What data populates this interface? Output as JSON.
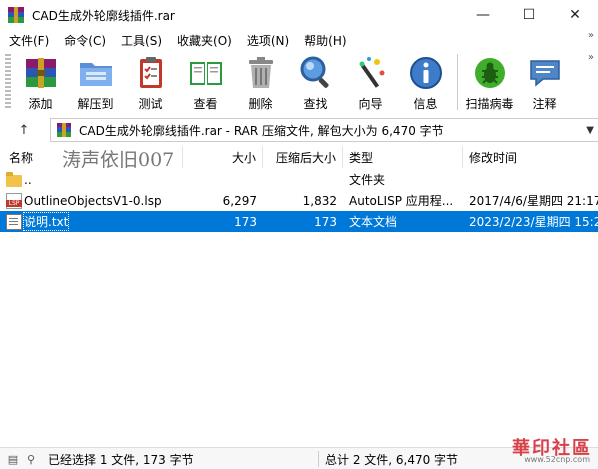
{
  "window": {
    "title": "CAD生成外轮廓线插件.rar",
    "minimize": "—",
    "maximize": "☐",
    "close": "✕"
  },
  "menu": [
    "文件(F)",
    "命令(C)",
    "工具(S)",
    "收藏夹(O)",
    "选项(N)",
    "帮助(H)"
  ],
  "toolbar": [
    {
      "label": "添加",
      "icon": "books-icon"
    },
    {
      "label": "解压到",
      "icon": "folder-extract-icon"
    },
    {
      "label": "测试",
      "icon": "clipboard-check-icon"
    },
    {
      "label": "查看",
      "icon": "open-book-icon"
    },
    {
      "label": "删除",
      "icon": "trash-icon"
    },
    {
      "label": "查找",
      "icon": "magnifier-icon"
    },
    {
      "label": "向导",
      "icon": "wand-icon"
    },
    {
      "label": "信息",
      "icon": "info-icon"
    },
    {
      "label": "扫描病毒",
      "icon": "bug-scan-icon"
    },
    {
      "label": "注释",
      "icon": "comment-icon"
    }
  ],
  "address": {
    "text": "CAD生成外轮廓线插件.rar - RAR 压缩文件, 解包大小为 6,470 字节"
  },
  "columns": {
    "name": "名称",
    "size": "大小",
    "packed": "压缩后大小",
    "type": "类型",
    "mtime": "修改时间"
  },
  "watermark": "涛声依旧007",
  "files": [
    {
      "name": "..",
      "size": "",
      "packed": "",
      "type": "文件夹",
      "mtime": "",
      "kind": "folder",
      "selected": false
    },
    {
      "name": "OutlineObjectsV1-0.lsp",
      "size": "6,297",
      "packed": "1,832",
      "type": "AutoLISP 应用程...",
      "mtime": "2017/4/6/星期四 21:17",
      "kind": "lsp",
      "selected": false
    },
    {
      "name": "说明.txt",
      "size": "173",
      "packed": "173",
      "type": "文本文档",
      "mtime": "2023/2/23/星期四 15:2",
      "kind": "txt",
      "selected": true
    }
  ],
  "status": {
    "left": "已经选择 1 文件, 173 字节",
    "right": "总计 2 文件, 6,470 字节"
  },
  "brand": {
    "text": "華印社區",
    "url": "www.52cnp.com"
  },
  "colors": {
    "selection": "#0078d7"
  }
}
